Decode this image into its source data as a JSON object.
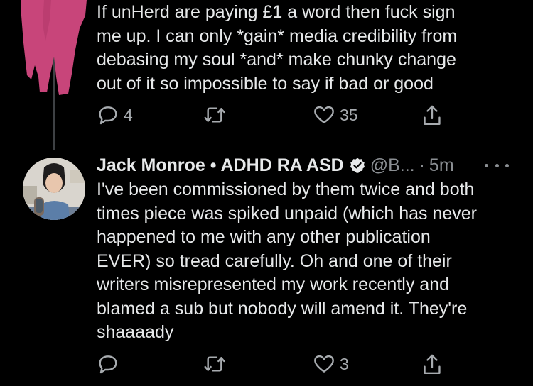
{
  "tweet1": {
    "text_lines": [
      "If unHerd are paying £1 a word then fuck sign",
      "me up. I can only *gain* media credibility from",
      "debasing my soul *and* make chunky change",
      "out of it so impossible to say if bad or good"
    ],
    "replies": "4",
    "likes": "35"
  },
  "tweet2": {
    "display_name": "Jack Monroe • ADHD RA ASD",
    "handle": "@B...",
    "separator": "·",
    "time": "5m",
    "text_lines": [
      "I've been commissioned by them twice and both",
      "times piece was spiked unpaid (which has never",
      "happened to me with any other publication",
      "EVER) so tread carefully. Oh and one of their",
      "writers misrepresented my work recently and",
      "blamed a sub but nobody will amend it. They're",
      "shaaaady"
    ],
    "likes": "3"
  },
  "icons": {
    "reply": "speech-bubble-icon",
    "retweet": "retweet-icon",
    "like": "heart-icon",
    "share": "share-icon",
    "verified": "verified-badge-icon",
    "more": "more-dots-icon"
  },
  "colors": {
    "background": "#000000",
    "text": "#e7e9ea",
    "secondary": "#8b8f93",
    "redaction": "#c8457a"
  }
}
